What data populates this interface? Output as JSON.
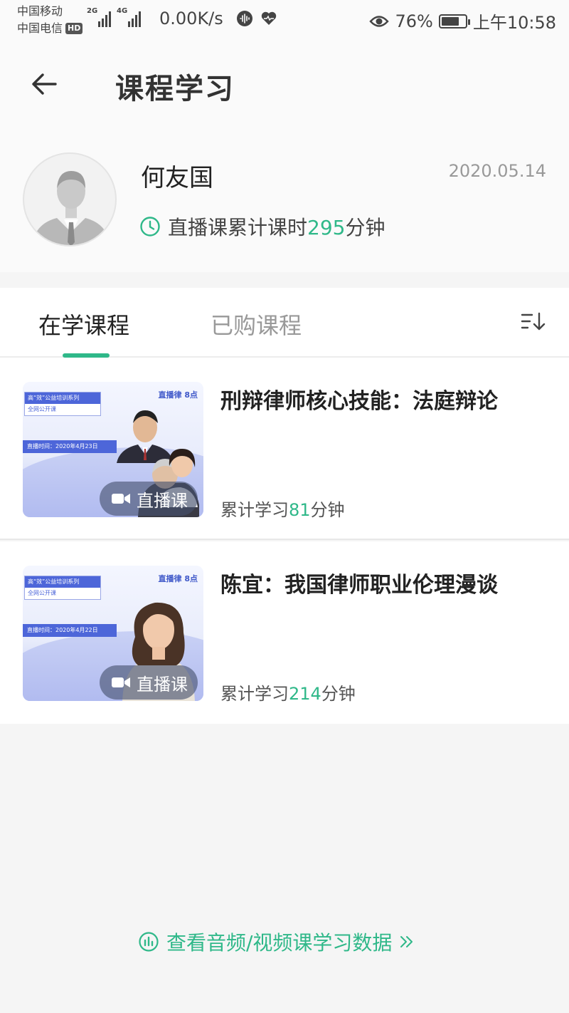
{
  "status_bar": {
    "carrier_1": "中国移动",
    "carrier_2": "中国电信",
    "hd_label": "HD",
    "signal_1_tag": "2G",
    "signal_2_tag": "4G",
    "net_speed": "0.00K/s",
    "battery_percent": "76%",
    "battery_level": 0.76,
    "time": "上午10:58"
  },
  "header": {
    "title": "课程学习"
  },
  "profile": {
    "name": "何友国",
    "date": "2020.05.14",
    "hours_prefix": "直播课累计课时",
    "hours_value": "295",
    "hours_unit": "分钟"
  },
  "tabs": {
    "active": "在学课程",
    "inactive": "已购课程"
  },
  "courses": [
    {
      "title": "刑辩律师核心技能：法庭辩论",
      "badge": "直播课",
      "progress_prefix": "累计学习",
      "progress_value": "81",
      "progress_unit": "分钟",
      "thumb_series_top": "高“效”公益培训系列",
      "thumb_series_bottom": "全网公开课",
      "thumb_date": "直播时间：2020年4月23日",
      "thumb_logo": "直播律 8点"
    },
    {
      "title": "陈宜：我国律师职业伦理漫谈",
      "badge": "直播课",
      "progress_prefix": "累计学习",
      "progress_value": "214",
      "progress_unit": "分钟",
      "thumb_series_top": "高“效”公益培训系列",
      "thumb_series_bottom": "全网公开课",
      "thumb_date": "直播时间：2020年4月22日",
      "thumb_logo": "直播律 8点"
    }
  ],
  "footer": {
    "data_link": "查看音频/视频课学习数据"
  },
  "colors": {
    "accent": "#2fb889",
    "thumb_blue": "#4d66d9"
  },
  "icons": {
    "back": "arrow-left",
    "clock": "clock",
    "sort": "sort-descending",
    "camera": "video-camera",
    "chart": "bar-chart-circle",
    "chevrons": "double-chevron-right"
  }
}
